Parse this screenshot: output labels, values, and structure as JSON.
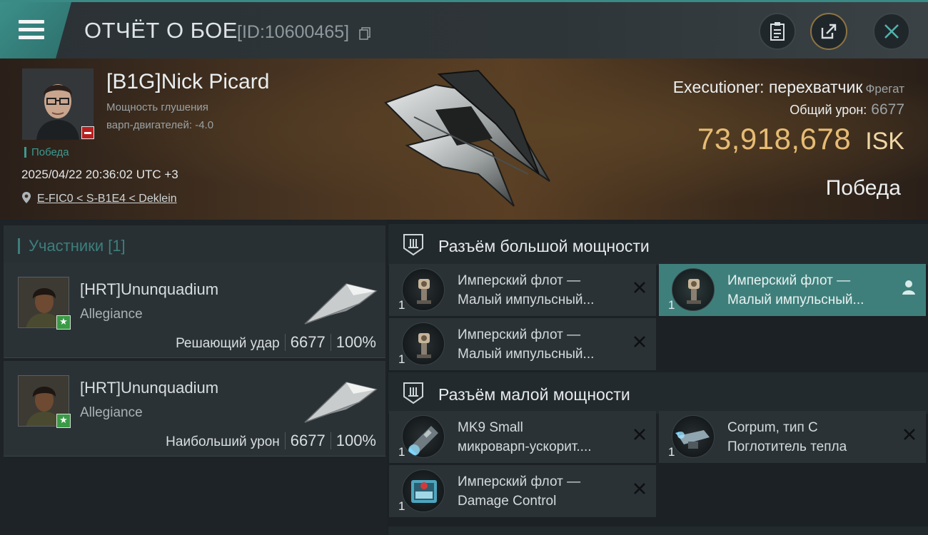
{
  "header": {
    "title": "ОТЧЁТ О БОЕ",
    "report_id": "[ID:10600465]"
  },
  "victim": {
    "name": "[B1G]Nick Picard",
    "stat_line_1": "Мощность глушения",
    "stat_line_2": "варп-двигателей: -4.0",
    "tag": "Победа",
    "datetime": "2025/04/22 20:36:02 UTC +3",
    "location": "E-FIC0 < S-B1E4 < Deklein",
    "ship_type": "Executioner: перехватчик",
    "ship_class": "Фрегат",
    "total_damage_label": "Общий урон:",
    "total_damage": "6677",
    "isk_value": "73,918,678",
    "isk_unit": "ISK",
    "result": "Победа"
  },
  "participants": {
    "title": "Участники [1]",
    "rows": [
      {
        "name": "[HRT]Ununquadium",
        "corp": "Allegiance",
        "role": "Решающий удар",
        "damage": "6677",
        "percent": "100%"
      },
      {
        "name": "[HRT]Ununquadium",
        "corp": "Allegiance",
        "role": "Наибольший урон",
        "damage": "6677",
        "percent": "100%"
      }
    ]
  },
  "fitting": {
    "high_slots": {
      "title": "Разъём большой мощности",
      "items": [
        {
          "qty": "1",
          "line1": "Имперский флот —",
          "line2": "Малый импульсный...",
          "icon": "pulse-laser-icon"
        },
        {
          "qty": "1",
          "line1": "Имперский флот —",
          "line2": "Малый импульсный...",
          "icon": "pulse-laser-icon"
        },
        {
          "qty": "1",
          "line1": "Имперский флот —",
          "line2": "Малый импульсный...",
          "icon": "pulse-laser-icon"
        }
      ]
    },
    "low_slots": {
      "title": "Разъём малой мощности",
      "items": [
        {
          "qty": "1",
          "line1": "MK9 Small",
          "line2": "микроварп-ускорит....",
          "icon": "microwarpdrive-icon"
        },
        {
          "qty": "1",
          "line1": "Corpum, тип C",
          "line2": "Поглотитель тепла",
          "icon": "heat-sink-icon"
        },
        {
          "qty": "1",
          "line1": "Имперский флот —",
          "line2": "Damage Control",
          "icon": "damage-control-icon"
        }
      ]
    }
  },
  "colors": {
    "accent": "#3c8f8a",
    "isk": "#e6bc74",
    "active_slot": "#3f7f7b"
  }
}
